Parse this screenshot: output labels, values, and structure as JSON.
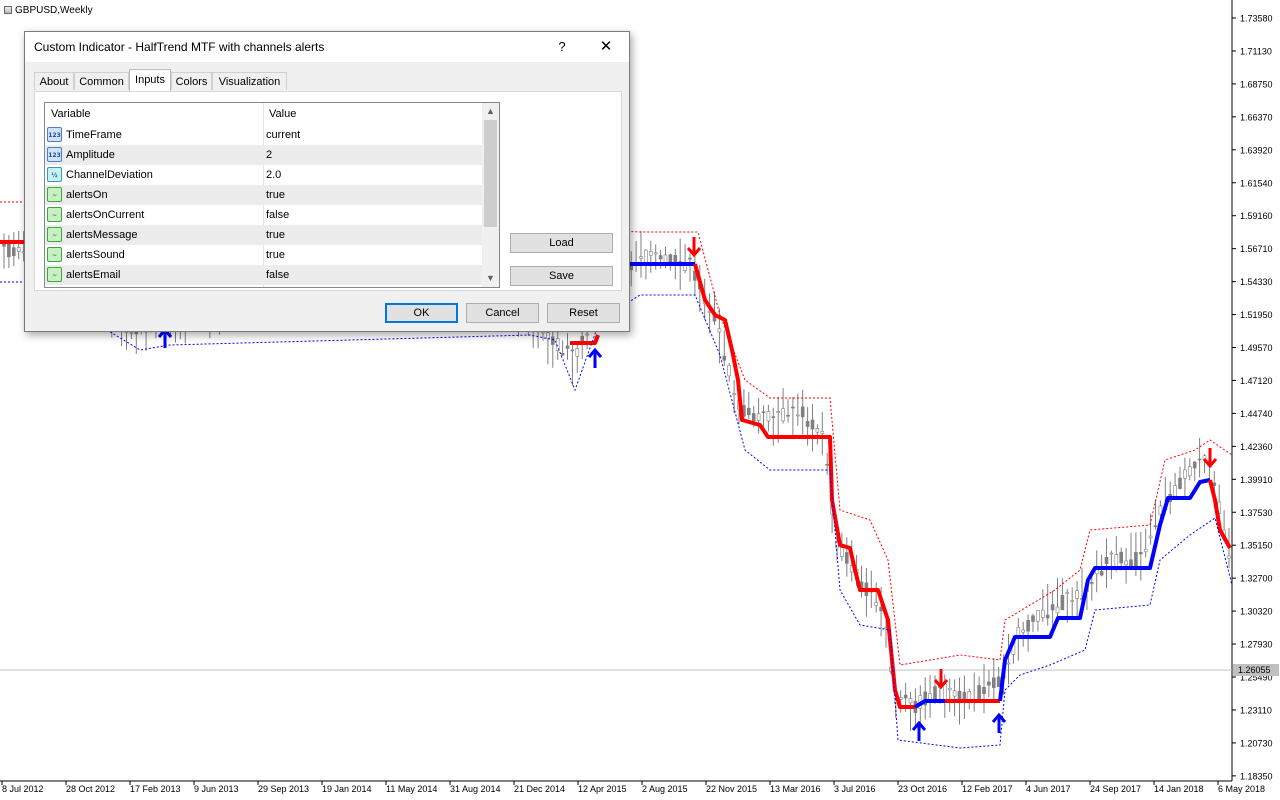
{
  "chart": {
    "symbol_label": "GBPUSD,Weekly",
    "price_labels": [
      "1.73580",
      "1.71130",
      "1.68750",
      "1.66370",
      "1.63920",
      "1.61540",
      "1.59160",
      "1.56710",
      "1.54330",
      "1.51950",
      "1.49570",
      "1.47120",
      "1.44740",
      "1.42360",
      "1.39910",
      "1.37530",
      "1.35150",
      "1.32700",
      "1.30320",
      "1.27930",
      "1.25490",
      "1.23110",
      "1.20730",
      "1.18350"
    ],
    "current_price": "1.26055",
    "date_labels": [
      "8 Jul 2012",
      "28 Oct 2012",
      "17 Feb 2013",
      "9 Jun 2013",
      "29 Sep 2013",
      "19 Jan 2014",
      "11 May 2014",
      "31 Aug 2014",
      "21 Dec 2014",
      "12 Apr 2015",
      "2 Aug 2015",
      "22 Nov 2015",
      "13 Mar 2016",
      "3 Jul 2016",
      "23 Oct 2016",
      "12 Feb 2017",
      "4 Jun 2017",
      "24 Sep 2017",
      "14 Jan 2018",
      "6 May 2018"
    ],
    "colors": {
      "up_line": "#0000ff",
      "down_line": "#ff0000",
      "candles": "#808080"
    },
    "arrows": [
      "up",
      "up",
      "down",
      "down",
      "up",
      "down",
      "up",
      "down"
    ]
  },
  "dialog": {
    "title": "Custom Indicator - HalfTrend MTF with channels alerts",
    "help_label": "?",
    "close_label": "✕",
    "tabs": [
      "About",
      "Common",
      "Inputs",
      "Colors",
      "Visualization"
    ],
    "active_tab": "Inputs",
    "grid": {
      "headers": {
        "variable": "Variable",
        "value": "Value"
      },
      "rows": [
        {
          "name": "TimeFrame",
          "value": "current",
          "icon": "int-icon"
        },
        {
          "name": "Amplitude",
          "value": "2",
          "icon": "int-icon"
        },
        {
          "name": "ChannelDeviation",
          "value": "2.0",
          "icon": "double-icon"
        },
        {
          "name": "alertsOn",
          "value": "true",
          "icon": "bool-icon"
        },
        {
          "name": "alertsOnCurrent",
          "value": "false",
          "icon": "bool-icon"
        },
        {
          "name": "alertsMessage",
          "value": "true",
          "icon": "bool-icon"
        },
        {
          "name": "alertsSound",
          "value": "true",
          "icon": "bool-icon"
        },
        {
          "name": "alertsEmail",
          "value": "false",
          "icon": "bool-icon"
        }
      ],
      "icon_glyphs": {
        "int": "123",
        "dbl": "½",
        "bool": "~"
      }
    },
    "buttons": {
      "load": "Load",
      "save": "Save",
      "ok": "OK",
      "cancel": "Cancel",
      "reset": "Reset"
    }
  }
}
